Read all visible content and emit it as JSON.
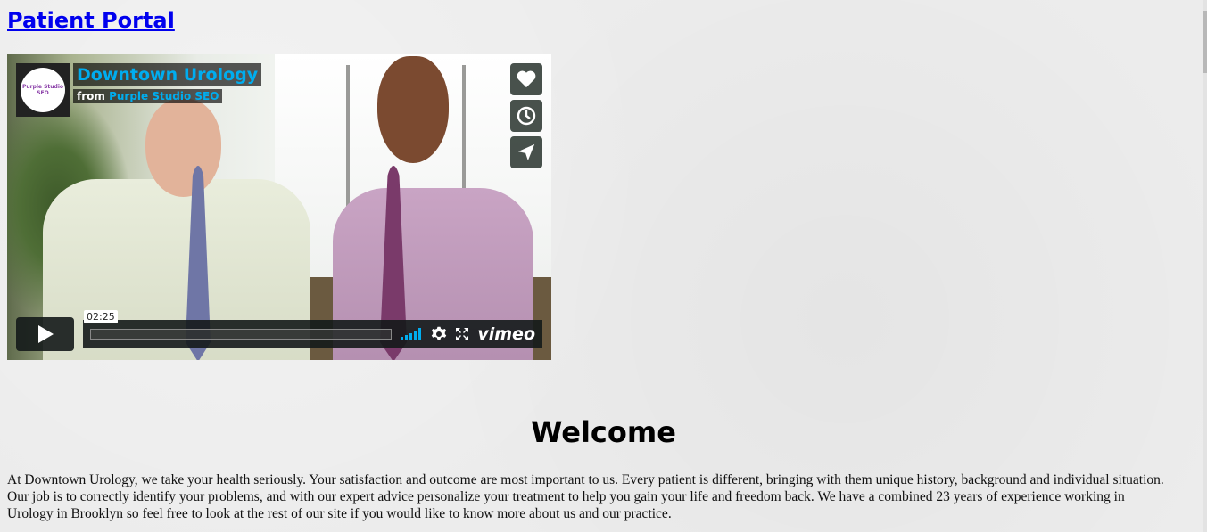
{
  "header": {
    "portal_link": "Patient Portal"
  },
  "video": {
    "title": "Downtown Urology",
    "from_prefix": "from",
    "owner": "Purple Studio SEO",
    "avatar_text": "Purple Studio SEO",
    "timestamp": "02:25",
    "brand": "vimeo",
    "side_buttons": [
      "heart-icon",
      "clock-icon",
      "send-icon"
    ],
    "progress": 0
  },
  "main": {
    "heading": "Welcome",
    "intro": "At Downtown Urology, we take your health seriously. Your satisfaction and outcome are most important to us. Every patient is different, bringing with them unique history, background and individual situation. Our job is to correctly identify your problems, and with our expert advice personalize your treatment to help you gain your life and freedom back. We have a combined 23 years of experience working in Urology in Brooklyn so feel free to look at the rest of our site if you would like to know more about us and our practice."
  },
  "colors": {
    "link": "#0000ee",
    "vimeo_accent": "#00adef"
  }
}
